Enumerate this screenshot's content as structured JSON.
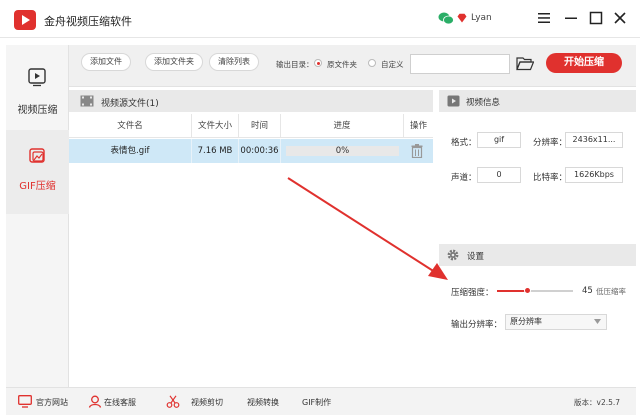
{
  "app": {
    "title": "金舟视频压缩软件",
    "username": "Lyan"
  },
  "nav": {
    "video_compress": "视频压缩",
    "gif_compress": "GIF压缩"
  },
  "toolbar": {
    "add_file": "添加文件",
    "add_folder": "添加文件夹",
    "clear_list": "清除列表",
    "output_label": "输出目录：",
    "option_source": "原文件夹",
    "option_custom": "自定义",
    "path_value": "",
    "start_label": "开始压缩"
  },
  "source_panel": {
    "title": "视频源文件(1)",
    "columns": [
      "文件名",
      "文件大小",
      "时间",
      "进度",
      "操作"
    ],
    "rows": [
      {
        "name": "表情包.gif",
        "size": "7.16 MB",
        "time": "00:00:36",
        "progress_text": "0%",
        "progress": 0
      }
    ]
  },
  "info_panel": {
    "title": "视频信息",
    "format_label": "格式：",
    "format_value": "gif",
    "resolution_label": "分辨率：",
    "resolution_value": "2436x11...",
    "channel_label": "声道：",
    "channel_value": "0",
    "bitrate_label": "比特率：",
    "bitrate_value": "1626Kbps"
  },
  "settings": {
    "title": "设置",
    "strength_label": "压缩强度：",
    "strength_value": "45",
    "strength_hint": "低压缩率",
    "strength_fraction": 0.4,
    "resolution_label": "输出分辨率：",
    "resolution_selected": "原分辨率"
  },
  "bottom": {
    "website": "官方网站",
    "support": "在线客服",
    "edit": "视频剪切",
    "convert": "视频转换",
    "gif": "GIF制作",
    "version": "版本：v2.5.7"
  },
  "colors": {
    "accent": "#e0312e",
    "row_selected": "#cfe8f7"
  }
}
